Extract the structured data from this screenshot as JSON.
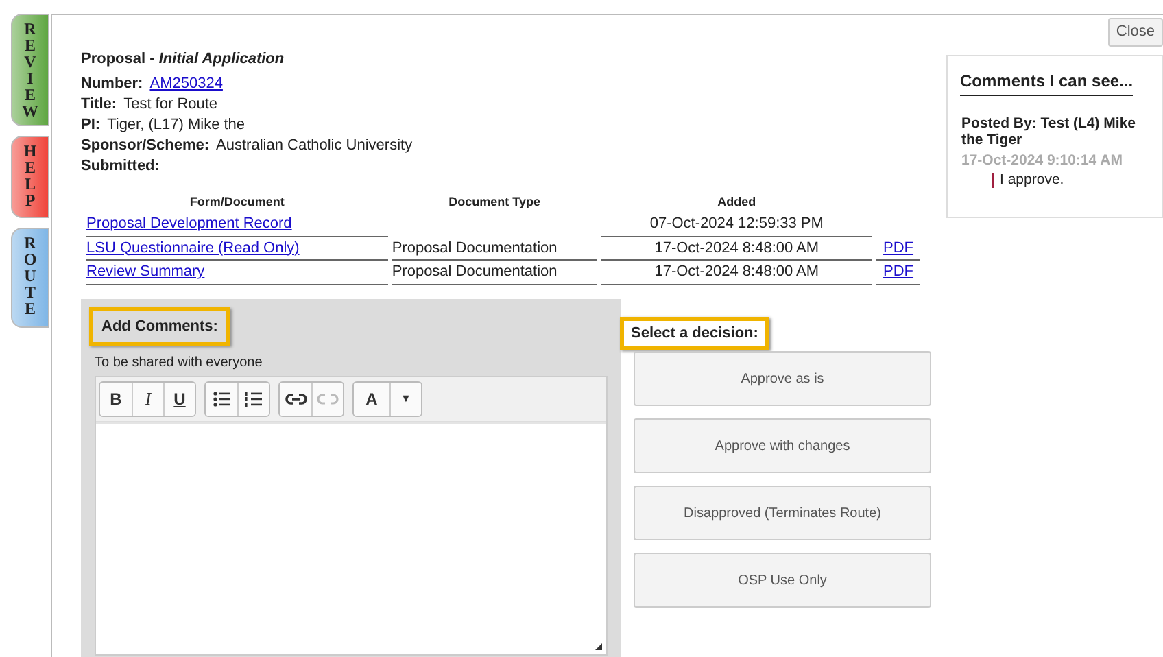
{
  "side_tabs": [
    {
      "label": "REVIEW",
      "color": "#5fa641"
    },
    {
      "label": "HELP",
      "color": "#f0443a"
    },
    {
      "label": "ROUTE",
      "color": "#7fb6e6"
    }
  ],
  "close_button": "Close",
  "header": {
    "title": "Proposal - *Initial Application*",
    "fields": [
      {
        "label": "Number:",
        "value": "AM250324",
        "kind": "link"
      },
      {
        "label": "Title:",
        "value": "Test for Route",
        "kind": "text"
      },
      {
        "label": "PI:",
        "value": "Tiger, (L17) Mike the",
        "kind": "text"
      },
      {
        "label": "Sponsor/Scheme:",
        "value": "Australian Catholic University",
        "kind": "text"
      },
      {
        "label": "Submitted:"
      }
    ]
  },
  "table": {
    "columns": [
      "Form/Document",
      "Document Type",
      "Added"
    ],
    "rows": [
      {
        "document": "Proposal Development Record",
        "added": "07-Oct-2024 12:59:33 PM"
      },
      {
        "document": "LSU Questionnaire (Read Only)",
        "type": "Proposal Documentation",
        "added": "17-Oct-2024 8:48:00 AM",
        "file": "PDF"
      },
      {
        "document": "Review Summary",
        "type": "Proposal Documentation",
        "added": "17-Oct-2024 8:48:00 AM",
        "file": "PDF"
      }
    ]
  },
  "comments_form": {
    "heading": "Add Comments:",
    "hint": "To be shared with everyone",
    "toolbar": [
      [
        {
          "kind": "bold",
          "label": "B",
          "disabled": false
        },
        {
          "kind": "italic",
          "label": "I",
          "disabled": false
        },
        {
          "kind": "underline",
          "label": "U",
          "disabled": false
        }
      ],
      [
        {
          "kind": "bullets",
          "disabled": false
        },
        {
          "kind": "numbers",
          "disabled": false
        }
      ],
      [
        {
          "kind": "link",
          "disabled": false
        },
        {
          "kind": "unlink",
          "disabled": true
        }
      ],
      [
        {
          "kind": "color",
          "label": "A",
          "disabled": false
        },
        {
          "kind": "dropdown",
          "label": "▼",
          "disabled": false
        }
      ]
    ]
  },
  "decision": {
    "heading": "Select a decision:",
    "buttons": [
      "Approve as is",
      "Approve with changes",
      "Disapproved (Terminates Route)",
      "OSP Use Only"
    ]
  },
  "comments_panel": {
    "heading": "Comments I can see...",
    "comments": [
      {
        "author": "Posted By: Test (L4) Mike the Tiger",
        "time": "17-Oct-2024 9:10:14 AM",
        "text": "I approve."
      }
    ]
  }
}
